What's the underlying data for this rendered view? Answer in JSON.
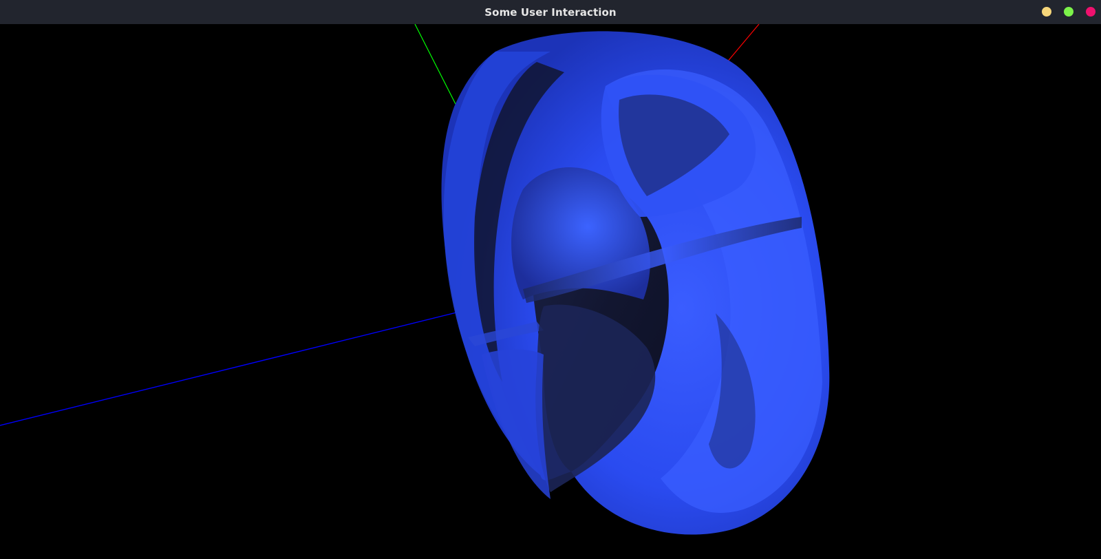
{
  "window": {
    "title": "Some User Interaction",
    "controls": {
      "minimize_color": "#f6d67a",
      "maximize_color": "#7cf24a",
      "close_color": "#f0116e"
    }
  },
  "scene": {
    "background": "#000000",
    "object": "blue-torus-shape",
    "axes": {
      "x_color": "#ff0000",
      "y_color": "#00ff00",
      "z_color": "#0000ff"
    },
    "shading_colors": {
      "highlight": "#3a5dff",
      "base": "#2443e0",
      "shadow": "#141a3a"
    }
  }
}
